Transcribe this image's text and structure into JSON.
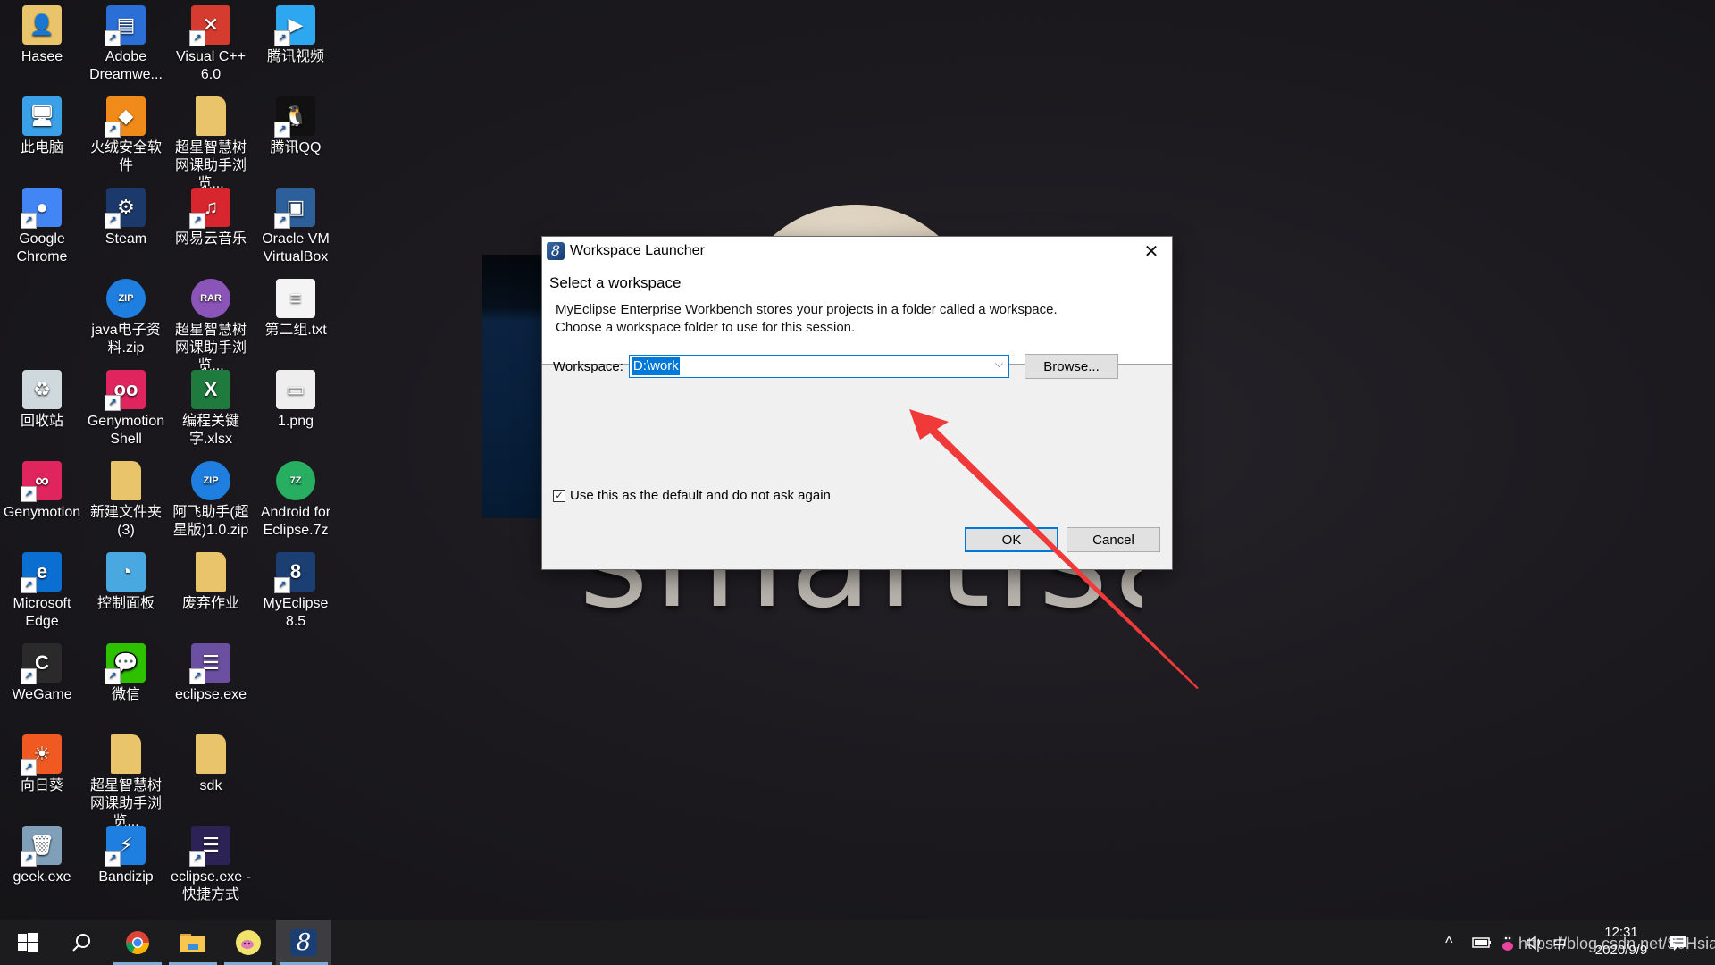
{
  "wallpaper": {
    "brand_text": "smartisan"
  },
  "desktop_icons": [
    {
      "label": "Hasee",
      "icon": "user-folder-icon",
      "color": "#e9c46a",
      "glyph": "👤",
      "shortcut": false
    },
    {
      "label": "Adobe Dreamwe...",
      "icon": "dreamweaver-icon",
      "color": "#2b6fd6",
      "glyph": "▤",
      "shortcut": true
    },
    {
      "label": "Visual C++ 6.0",
      "icon": "visual-cpp-icon",
      "color": "#d63b2f",
      "glyph": "✕",
      "shortcut": true
    },
    {
      "label": "腾讯视频",
      "icon": "tencent-video-icon",
      "color": "#2da8f0",
      "glyph": "▶",
      "shortcut": true
    },
    {
      "label": "此电脑",
      "icon": "this-pc-icon",
      "color": "#3aa0e8",
      "glyph": "🖥",
      "shortcut": false
    },
    {
      "label": "火绒安全软件",
      "icon": "huorong-icon",
      "color": "#f08a18",
      "glyph": "◆",
      "shortcut": true
    },
    {
      "label": "超星智慧树网课助手浏览...",
      "icon": "folder-icon",
      "color": "#e9c46a",
      "glyph": "",
      "shortcut": false
    },
    {
      "label": "腾讯QQ",
      "icon": "qq-icon",
      "color": "#111111",
      "glyph": "🐧",
      "shortcut": true
    },
    {
      "label": "Google Chrome",
      "icon": "chrome-icon",
      "color": "#4285f4",
      "glyph": "●",
      "shortcut": true
    },
    {
      "label": "Steam",
      "icon": "steam-icon",
      "color": "#1b3a6b",
      "glyph": "⚙",
      "shortcut": true
    },
    {
      "label": "网易云音乐",
      "icon": "netease-music-icon",
      "color": "#d7262e",
      "glyph": "♫",
      "shortcut": true
    },
    {
      "label": "Oracle VM VirtualBox",
      "icon": "virtualbox-icon",
      "color": "#2d5f9a",
      "glyph": "▣",
      "shortcut": true
    },
    {
      "label": "java电子资料.zip",
      "icon": "bandizip-zip-icon",
      "color": "#1e7fe0",
      "glyph": "ZIP",
      "shortcut": false
    },
    {
      "label": "超星智慧树网课助手浏览...",
      "icon": "bandizip-rar-icon",
      "color": "#8a54b8",
      "glyph": "RAR",
      "shortcut": false
    },
    {
      "label": "第二组.txt",
      "icon": "text-file-icon",
      "color": "#f4f4f4",
      "glyph": "≡",
      "shortcut": false
    },
    {
      "label": "回收站",
      "icon": "recycle-bin-icon",
      "color": "#cfd8dc",
      "glyph": "♻",
      "shortcut": false
    },
    {
      "label": "Genymotion Shell",
      "icon": "genymotion-shell-icon",
      "color": "#e0245e",
      "glyph": "oo",
      "shortcut": true
    },
    {
      "label": "编程关键字.xlsx",
      "icon": "excel-file-icon",
      "color": "#1f7a3e",
      "glyph": "X",
      "shortcut": false
    },
    {
      "label": "1.png",
      "icon": "image-file-icon",
      "color": "#eeeeee",
      "glyph": "▭",
      "shortcut": false
    },
    {
      "label": "Genymotion",
      "icon": "genymotion-icon",
      "color": "#e0245e",
      "glyph": "∞",
      "shortcut": true
    },
    {
      "label": "新建文件夹 (3)",
      "icon": "folder-icon",
      "color": "#e9c46a",
      "glyph": "",
      "shortcut": false
    },
    {
      "label": "阿飞助手(超星版)1.0.zip",
      "icon": "bandizip-zip-icon",
      "color": "#1e7fe0",
      "glyph": "ZIP",
      "shortcut": false
    },
    {
      "label": "Android for Eclipse.7z",
      "icon": "bandizip-7z-icon",
      "color": "#27ae60",
      "glyph": "7Z",
      "shortcut": false
    },
    {
      "label": "Microsoft Edge",
      "icon": "edge-icon",
      "color": "#0a6fd1",
      "glyph": "e",
      "shortcut": true
    },
    {
      "label": "控制面板",
      "icon": "control-panel-icon",
      "color": "#4aa8e0",
      "glyph": "◔",
      "shortcut": false
    },
    {
      "label": "废弃作业",
      "icon": "folder-icon",
      "color": "#e9c46a",
      "glyph": "",
      "shortcut": false
    },
    {
      "label": "MyEclipse 8.5",
      "icon": "myeclipse-icon",
      "color": "#1b3f72",
      "glyph": "8",
      "shortcut": true
    },
    {
      "label": "WeGame",
      "icon": "wegame-icon",
      "color": "#2a2a2a",
      "glyph": "C",
      "shortcut": true
    },
    {
      "label": "微信",
      "icon": "wechat-icon",
      "color": "#2dc100",
      "glyph": "💬",
      "shortcut": true
    },
    {
      "label": "eclipse.exe",
      "icon": "eclipse-icon",
      "color": "#6b4fa0",
      "glyph": "☰",
      "shortcut": true
    },
    {
      "label": "向日葵",
      "icon": "sunlogin-icon",
      "color": "#f05a22",
      "glyph": "☀",
      "shortcut": true
    },
    {
      "label": "超星智慧树网课助手浏览...",
      "icon": "folder-icon",
      "color": "#e9c46a",
      "glyph": "",
      "shortcut": false
    },
    {
      "label": "sdk",
      "icon": "folder-icon",
      "color": "#e9c46a",
      "glyph": "",
      "shortcut": false
    },
    {
      "label": "geek.exe",
      "icon": "geek-uninstaller-icon",
      "color": "#7fa0b8",
      "glyph": "🗑",
      "shortcut": true
    },
    {
      "label": "Bandizip",
      "icon": "bandizip-icon",
      "color": "#1e7fe0",
      "glyph": "⚡",
      "shortcut": true
    },
    {
      "label": "eclipse.exe - 快捷方式",
      "icon": "eclipse-icon",
      "color": "#2c2255",
      "glyph": "☰",
      "shortcut": true
    }
  ],
  "dialog": {
    "title": "Workspace Launcher",
    "close_glyph": "✕",
    "heading": "Select a workspace",
    "description_line1": "MyEclipse Enterprise Workbench stores your projects in a folder called a workspace.",
    "description_line2": "Choose a workspace folder to use for this session.",
    "workspace_label": "Workspace:",
    "workspace_value": "D:\\work",
    "dropdown_glyph": "⌵",
    "browse_label": "Browse...",
    "default_checkbox_label": "Use this as the default and do not ask again",
    "default_checkbox_checked": true,
    "check_glyph": "✓",
    "ok_label": "OK",
    "cancel_label": "Cancel",
    "accent_color": "#0078d7"
  },
  "annotation": {
    "type": "red-arrow",
    "color": "#f03a3a",
    "points_to": "workspace-combo"
  },
  "taskbar": {
    "pinned": [
      {
        "name": "start",
        "icon": "windows-start-icon",
        "running": false
      },
      {
        "name": "search",
        "icon": "search-icon",
        "running": false
      },
      {
        "name": "chrome",
        "icon": "chrome-icon",
        "running": true
      },
      {
        "name": "file-explorer",
        "icon": "folder-icon",
        "running": true
      },
      {
        "name": "app",
        "icon": "cartoon-app-icon",
        "running": true
      },
      {
        "name": "myeclipse",
        "icon": "myeclipse-icon",
        "running": true,
        "active": true
      }
    ],
    "tray": {
      "chevron_glyph": "^",
      "ime_label": "中",
      "time": "12:31",
      "date": "2020/9/9",
      "notification_count": "1"
    },
    "watermark": "https://blog.csdn.net/SJHsiao"
  }
}
